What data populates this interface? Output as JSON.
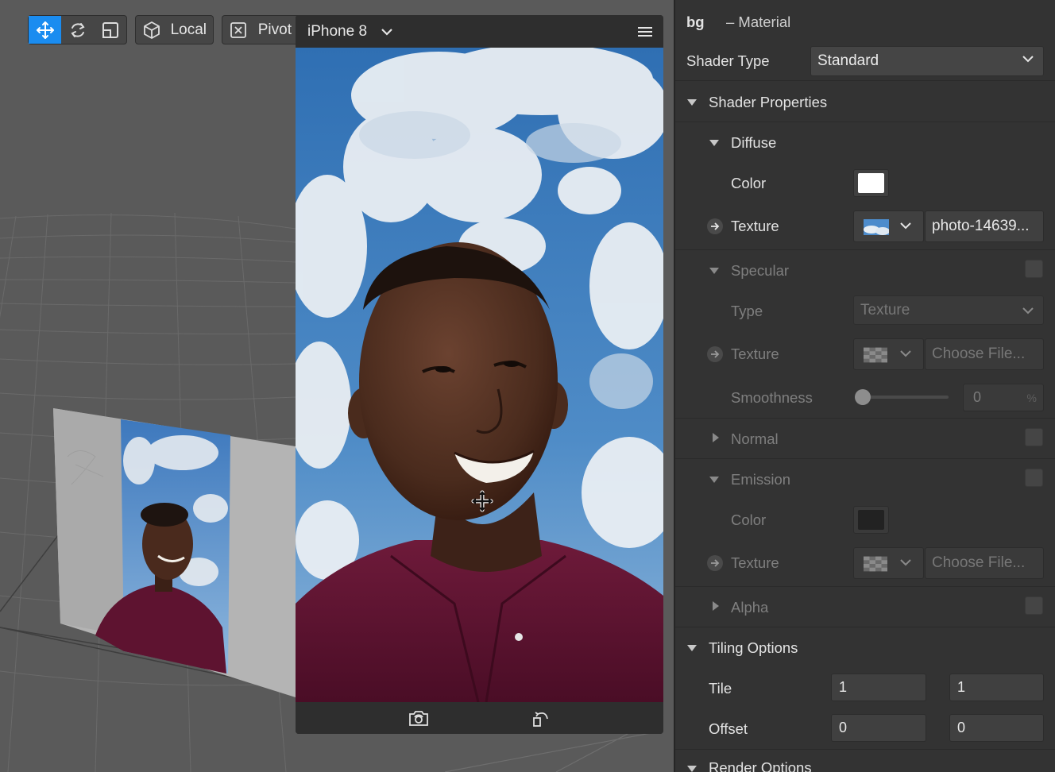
{
  "toolbar": {
    "local_label": "Local",
    "pivot_label": "Pivot"
  },
  "preview": {
    "device_label": "iPhone 8"
  },
  "inspector": {
    "object_name": "bg",
    "object_type": "– Material",
    "shader_type_label": "Shader Type",
    "shader_type_value": "Standard",
    "shader_properties_label": "Shader Properties",
    "diffuse": {
      "label": "Diffuse",
      "color_label": "Color",
      "color_value": "#ffffff",
      "texture_label": "Texture",
      "texture_file": "photo-14639..."
    },
    "specular": {
      "label": "Specular",
      "type_label": "Type",
      "type_value": "Texture",
      "texture_label": "Texture",
      "texture_file": "Choose File...",
      "smoothness_label": "Smoothness",
      "smoothness_value": "0",
      "smoothness_unit": "%",
      "smoothness_level": 0
    },
    "normal": {
      "label": "Normal"
    },
    "emission": {
      "label": "Emission",
      "color_label": "Color",
      "color_value": "#222222",
      "texture_label": "Texture",
      "texture_file": "Choose File..."
    },
    "alpha": {
      "label": "Alpha"
    },
    "tiling": {
      "label": "Tiling Options",
      "tile_label": "Tile",
      "tile_x": "1",
      "tile_y": "1",
      "offset_label": "Offset",
      "offset_x": "0",
      "offset_y": "0"
    },
    "render_options_label": "Render Options"
  },
  "colors": {
    "accent": "#1a8cf0",
    "panel_bg": "#333333",
    "viewport_bg": "#5a5a5a",
    "shirt": "#5e1330",
    "sky": "#3f7fc2"
  }
}
